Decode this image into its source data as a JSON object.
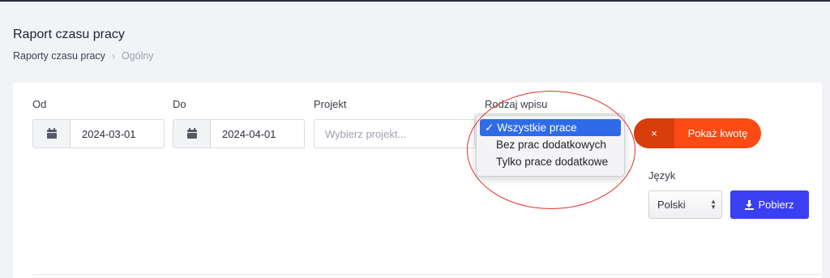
{
  "page": {
    "title": "Raport czasu pracy",
    "breadcrumb": {
      "parent": "Raporty czasu pracy",
      "separator": "›",
      "current": "Ogólny"
    }
  },
  "filters": {
    "from": {
      "label": "Od",
      "value": "2024-03-01",
      "icon": "calendar-icon"
    },
    "to": {
      "label": "Do",
      "value": "2024-04-01",
      "icon": "calendar-icon"
    },
    "project": {
      "label": "Projekt",
      "placeholder": "Wybierz projekt..."
    },
    "entry_type": {
      "label": "Rodzaj wpisu",
      "options": [
        {
          "label": "Wszystkie prace",
          "selected": true
        },
        {
          "label": "Bez prac dodatkowych",
          "selected": false
        },
        {
          "label": "Tylko prace dodatkowe",
          "selected": false
        }
      ],
      "check_mark": "✓"
    }
  },
  "toggle_amount": {
    "icon": "×",
    "label": "Pokaż kwotę"
  },
  "language": {
    "label": "Język",
    "selected": "Polski"
  },
  "download": {
    "label": "Pobierz",
    "icon": "download-icon"
  },
  "colors": {
    "accent_orange": "#fb4a14",
    "accent_blue": "#3b3ff2",
    "selection_blue": "#2f6be8",
    "annotation_red": "#e2302a"
  }
}
